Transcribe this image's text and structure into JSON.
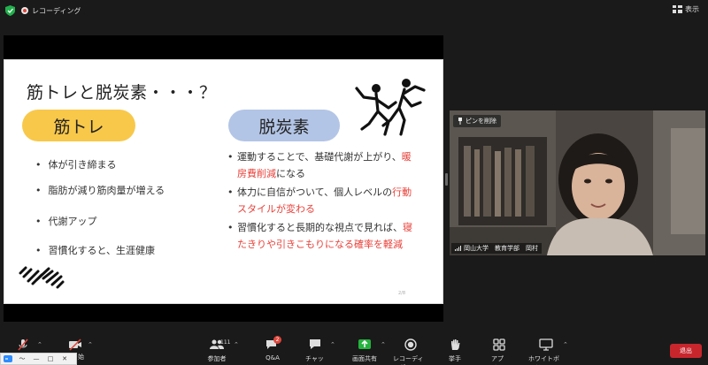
{
  "topbar": {
    "recording_label": "レコーディング",
    "view_label": "表示"
  },
  "slide": {
    "title": "筋トレと脱炭素・・・？",
    "pill_left": "筋トレ",
    "pill_right": "脱炭素",
    "left_bullets": [
      "体が引き締まる",
      "脂肪が減り筋肉量が増える",
      "代謝アップ",
      "習慣化すると、生涯健康"
    ],
    "right_bullets": [
      {
        "pre": "運動することで、基礎代謝が上がり、",
        "red": "暖房費削減",
        "post": "になる"
      },
      {
        "pre": "体力に自信がついて、個人レベルの",
        "red": "行動スタイルが変わる",
        "post": ""
      },
      {
        "pre": "習慣化すると長期的な視点で見れば、",
        "red": "寝たきりや引きこもりになる確率を軽減",
        "post": ""
      }
    ],
    "page_number": "2/8"
  },
  "video": {
    "unpin_label": "ピンを削除",
    "participant_name": "岡山大学　教育学部　岡村"
  },
  "toolbar": {
    "start_video_label": "始",
    "participants_label": "参加者",
    "participants_count": "111",
    "qa_label": "Q&A",
    "qa_badge": "2",
    "chat_label": "チャット",
    "share_label": "画面共有",
    "record_label": "レコーディング",
    "raise_hand_label": "挙手",
    "apps_label": "アプリ",
    "whiteboard_label": "ホワイトボード",
    "leave_label": "退出",
    "share_color": "#25b33e",
    "leave_color": "#c8262d"
  },
  "taskbar": {
    "app_label": "〜",
    "minimize": "—",
    "maximize": "□",
    "close": "✕"
  }
}
